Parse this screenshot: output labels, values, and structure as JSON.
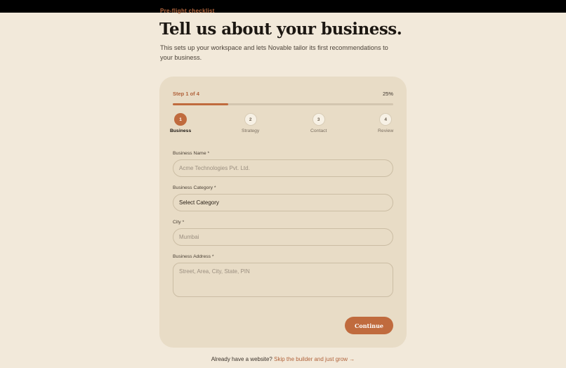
{
  "header": {
    "eyebrow": "Pre-flight checklist",
    "title": "Tell us about your business.",
    "subtitle": "This sets up your workspace and lets Novable tailor its first recommendations to your business."
  },
  "progress": {
    "label": "Step 1 of 4",
    "percent_label": "25%",
    "value": 0.25
  },
  "steps": [
    {
      "number": "1",
      "label": "Business",
      "state": "active"
    },
    {
      "number": "2",
      "label": "Strategy",
      "state": "pending"
    },
    {
      "number": "3",
      "label": "Contact",
      "state": "pending"
    },
    {
      "number": "4",
      "label": "Review",
      "state": "pending"
    }
  ],
  "form": {
    "business_name": {
      "label": "Business Name *",
      "placeholder": "Acme Technologies Pvt. Ltd."
    },
    "business_category": {
      "label": "Business Category *",
      "value": "Select Category"
    },
    "city": {
      "label": "City *",
      "placeholder": "Mumbai"
    },
    "business_address": {
      "label": "Business Address *",
      "placeholder": "Street, Area, City, State, PIN"
    },
    "continue_label": "Continue"
  },
  "footer": {
    "text": "Already have a website?",
    "link": "Skip the builder and just grow →"
  },
  "colors": {
    "background": "#f2e9da",
    "card": "#e8dcc6",
    "accent": "#c06b3e"
  }
}
